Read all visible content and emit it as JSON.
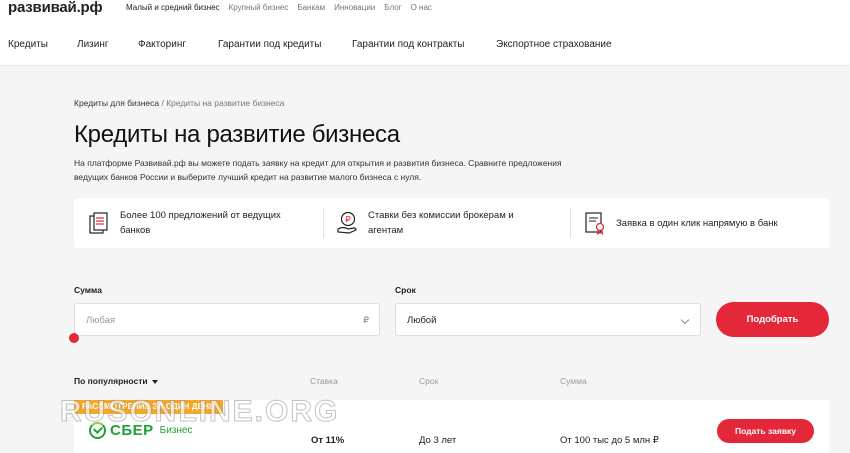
{
  "header": {
    "logo": "развивай.рф",
    "top_nav": [
      "Малый и средний бизнес",
      "Крупный бизнес",
      "Банкам",
      "Инновации",
      "Блог",
      "О нас"
    ]
  },
  "main_nav": [
    "Кредиты",
    "Лизинг",
    "Факторинг",
    "Гарантии под кредиты",
    "Гарантии под контракты",
    "Экспортное страхование"
  ],
  "breadcrumb": {
    "parent": "Кредиты для бизнеса",
    "separator": " / ",
    "current": "Кредиты на развитие бизнеса"
  },
  "page": {
    "title": "Кредиты на развитие бизнеса",
    "intro": "На платформе Развивай.рф вы можете подать заявку на кредит для открытия и развития бизнеса. Сравните предложения ведущих банков России и выберите лучший кредит на развитие малого бизнеса с нуля."
  },
  "features": [
    {
      "icon": "documents-icon",
      "text": "Более 100 предложений от ведущих банков"
    },
    {
      "icon": "ruble-hand-icon",
      "text": "Ставки без комиссии брокерам и агентам"
    },
    {
      "icon": "certificate-icon",
      "text": "Заявка в один клик напрямую в банк"
    }
  ],
  "filters": {
    "amount_label": "Сумма",
    "amount_placeholder": "Любая",
    "amount_currency": "₽",
    "term_label": "Срок",
    "term_value": "Любой",
    "submit": "Подобрать"
  },
  "list": {
    "sort_label": "По популярности",
    "columns": {
      "rate": "Ставка",
      "term": "Срок",
      "amount": "Сумма"
    },
    "offers": [
      {
        "badge": "РАССМОТРЕНИЕ ЗА ОДИН ДЕНЬ",
        "bank": "СБЕР",
        "bank_sub": "Бизнес",
        "rate": "От 11%",
        "term": "До 3 лет",
        "amount": "От 100 тыс до 5 млн ₽",
        "action": "Подать заявку"
      }
    ]
  },
  "watermark": "RUSONLINE.ORG",
  "colors": {
    "accent": "#e4283a",
    "badge": "#f5a623",
    "sber": "#21a038"
  }
}
